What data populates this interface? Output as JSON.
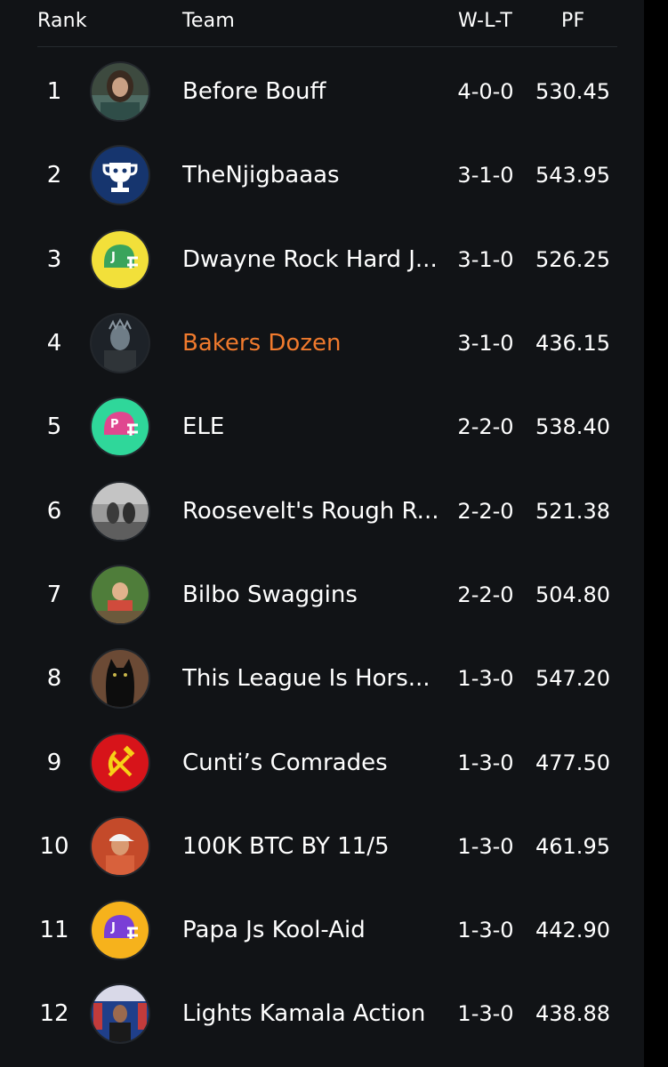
{
  "header": {
    "rank": "Rank",
    "team": "Team",
    "wlt": "W-L-T",
    "pf": "PF"
  },
  "colors": {
    "highlight": "#f07a2d",
    "background": "#111316"
  },
  "rows": [
    {
      "rank": "1",
      "team": "Before Bouff",
      "wlt": "4-0-0",
      "pf": "530.45",
      "avatar": "photo-avatar-man-long-hair"
    },
    {
      "rank": "2",
      "team": "TheNjigbaaas",
      "wlt": "3-1-0",
      "pf": "543.95",
      "avatar": "trophy-icon"
    },
    {
      "rank": "3",
      "team": "Dwayne Rock Hard J...",
      "wlt": "3-1-0",
      "pf": "526.25",
      "avatar": "helmet-j-icon"
    },
    {
      "rank": "4",
      "team": "Bakers Dozen",
      "wlt": "3-1-0",
      "pf": "436.15",
      "avatar": "photo-avatar-night-king"
    },
    {
      "rank": "5",
      "team": "ELE",
      "wlt": "2-2-0",
      "pf": "538.40",
      "avatar": "helmet-p-icon"
    },
    {
      "rank": "6",
      "team": "Roosevelt's Rough R...",
      "wlt": "2-2-0",
      "pf": "521.38",
      "avatar": "photo-avatar-historic"
    },
    {
      "rank": "7",
      "team": "Bilbo Swaggins",
      "wlt": "2-2-0",
      "pf": "504.80",
      "avatar": "photo-avatar-outdoor"
    },
    {
      "rank": "8",
      "team": "This League Is Hors...",
      "wlt": "1-3-0",
      "pf": "547.20",
      "avatar": "photo-avatar-black-cat"
    },
    {
      "rank": "9",
      "team": "Cunti’s Comrades",
      "wlt": "1-3-0",
      "pf": "477.50",
      "avatar": "hammer-sickle-icon"
    },
    {
      "rank": "10",
      "team": "100K BTC BY 11/5",
      "wlt": "1-3-0",
      "pf": "461.95",
      "avatar": "photo-avatar-man-cap"
    },
    {
      "rank": "11",
      "team": "Papa Js Kool-Aid",
      "wlt": "1-3-0",
      "pf": "442.90",
      "avatar": "helmet-j-purple-icon"
    },
    {
      "rank": "12",
      "team": "Lights Kamala Action",
      "wlt": "1-3-0",
      "pf": "438.88",
      "avatar": "photo-avatar-stage"
    }
  ]
}
